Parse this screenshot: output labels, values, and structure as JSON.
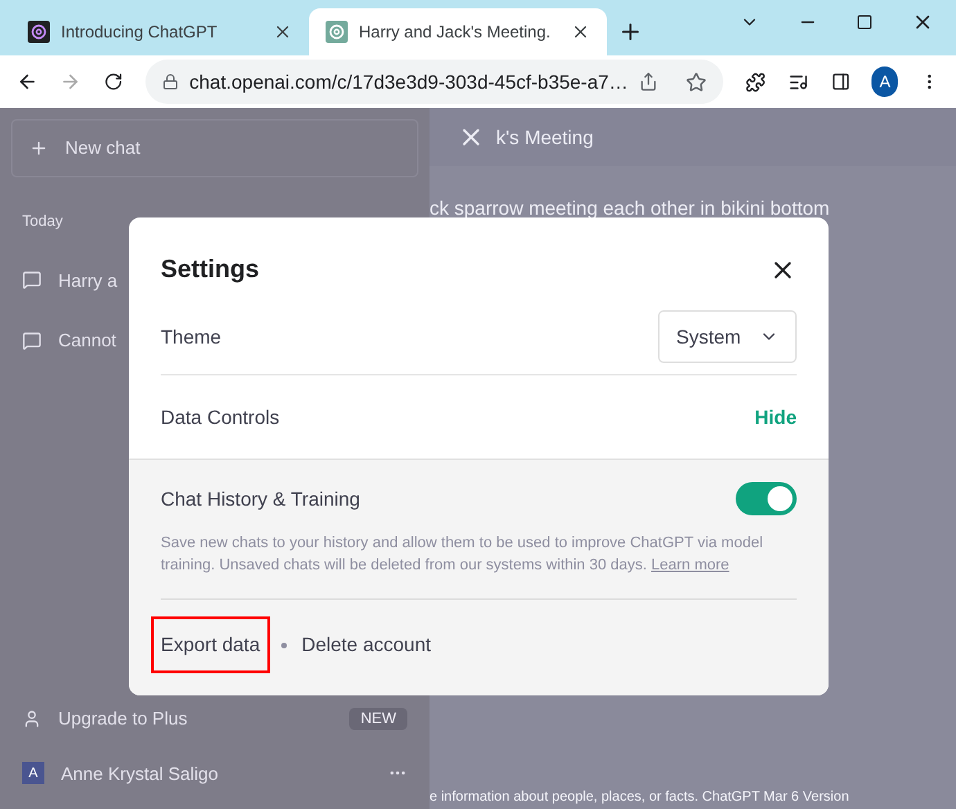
{
  "browser": {
    "tabs": [
      {
        "title": "Introducing ChatGPT",
        "selected": false
      },
      {
        "title": "Harry and Jack's Meeting.",
        "selected": true
      }
    ],
    "url": "chat.openai.com/c/17d3e3d9-303d-45cf-b35e-a7…",
    "profile": "A"
  },
  "sidebar": {
    "new_chat": "New chat",
    "section": "Today",
    "items": [
      "Harry a",
      "Cannot"
    ],
    "upgrade": "Upgrade to Plus",
    "badge": "NEW",
    "user": {
      "initial": "A",
      "name": "Anne Krystal Saligo"
    }
  },
  "main": {
    "header": "k's Meeting",
    "message": "ck sparrow meeting each other in bikini bottom",
    "footer": "e information about people, places, or facts. ChatGPT Mar 6 Version"
  },
  "dialog": {
    "title": "Settings",
    "theme": {
      "label": "Theme",
      "value": "System"
    },
    "data_controls": {
      "label": "Data Controls",
      "action": "Hide"
    },
    "history": {
      "label": "Chat History & Training",
      "on": true,
      "description": "Save new chats to your history and allow them to be used to improve ChatGPT via model training. Unsaved chats will be deleted from our systems within 30 days.",
      "link": "Learn more"
    },
    "actions": [
      {
        "label": "Export data",
        "highlighted": true
      },
      {
        "label": "Delete account",
        "highlighted": false
      }
    ]
  }
}
